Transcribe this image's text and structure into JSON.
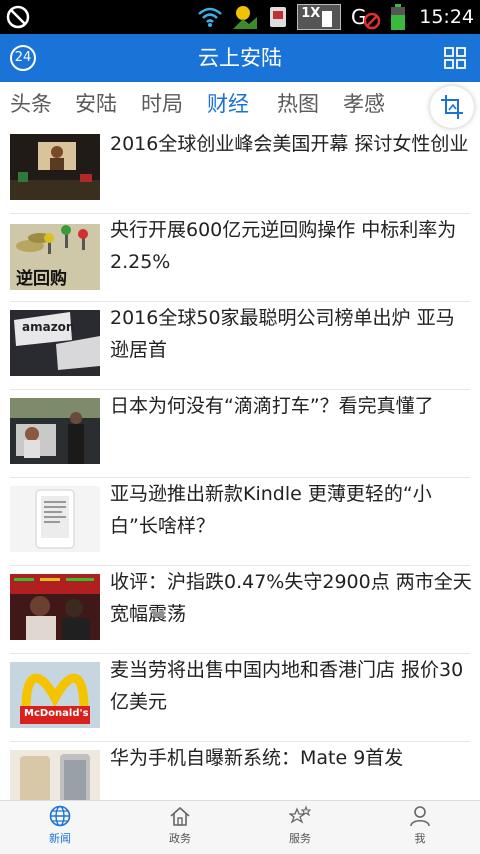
{
  "status_bar": {
    "time": "15:24",
    "sim_label": "1X"
  },
  "header": {
    "title": "云上安陆",
    "left_badge": "24"
  },
  "tabs": [
    {
      "label": "头条"
    },
    {
      "label": "安陆"
    },
    {
      "label": "时局"
    },
    {
      "label": "财经",
      "active": true
    },
    {
      "label": "热图"
    },
    {
      "label": "孝感"
    }
  ],
  "news": [
    {
      "title": "2016全球创业峰会美国开幕 探讨女性创业",
      "thumb": "stage-icon"
    },
    {
      "title": "央行开展600亿元逆回购操作 中标利率为2.25%",
      "thumb": "coins-icon",
      "thumb_text": "逆回购"
    },
    {
      "title": "2016全球50家最聪明公司榜单出炉 亚马逊居首",
      "thumb": "amazon-logo",
      "thumb_text": "amazon"
    },
    {
      "title": "日本为何没有“滴滴打车”？看完真懂了",
      "thumb": "car-icon"
    },
    {
      "title": "亚马逊推出新款Kindle 更薄更轻的“小白”长啥样？",
      "thumb": "kindle-icon"
    },
    {
      "title": "收评：沪指跌0.47%失守2900点 两市全天宽幅震荡",
      "thumb": "trader-icon"
    },
    {
      "title": "麦当劳将出售中国内地和香港门店 报价30亿美元",
      "thumb": "mcdonalds-logo",
      "thumb_text": "McDonald's"
    },
    {
      "title": "华为手机自曝新系统：Mate 9首发",
      "thumb": "phone-icon"
    }
  ],
  "bottom_nav": [
    {
      "label": "新闻",
      "icon": "globe-icon",
      "active": true
    },
    {
      "label": "政务",
      "icon": "home-icon"
    },
    {
      "label": "服务",
      "icon": "stars-icon"
    },
    {
      "label": "我",
      "icon": "user-icon"
    }
  ],
  "colors": {
    "accent": "#1a73d6",
    "status_bar": "#000000",
    "text": "#222222"
  }
}
